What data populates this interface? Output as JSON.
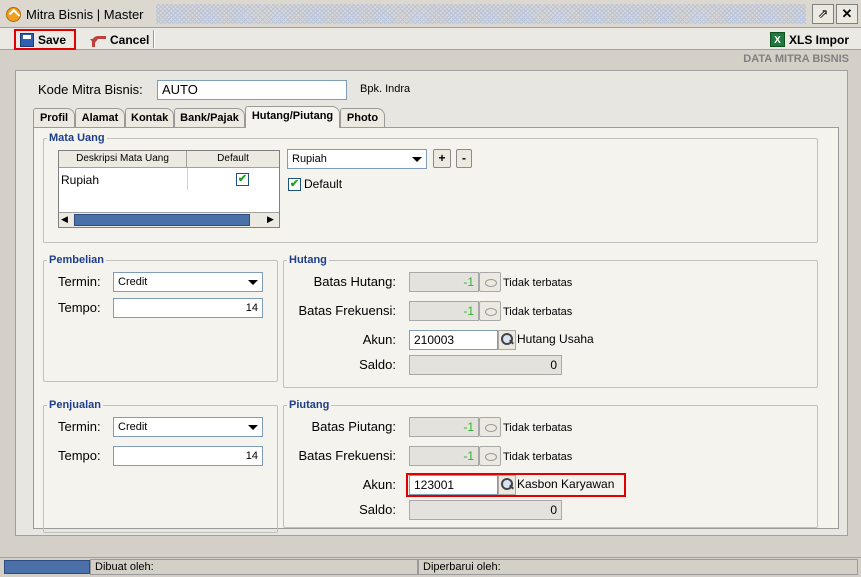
{
  "window": {
    "title": "Mitra Bisnis | Master",
    "restore_glyph": "⇗",
    "close_glyph": "✕"
  },
  "toolbar": {
    "save_label": "Save",
    "cancel_label": "Cancel",
    "xls_label": "XLS Impor"
  },
  "header": {
    "section_title": "DATA MITRA BISNIS",
    "kode_label": "Kode Mitra Bisnis:",
    "kode_value": "AUTO",
    "contact_name": "Bpk. Indra"
  },
  "tabs": [
    {
      "label": "Profil"
    },
    {
      "label": "Alamat"
    },
    {
      "label": "Kontak"
    },
    {
      "label": "Bank/Pajak"
    },
    {
      "label": "Hutang/Piutang",
      "active": true
    },
    {
      "label": "Photo"
    }
  ],
  "mata_uang": {
    "group_title": "Mata Uang",
    "col_desc": "Deskripsi Mata Uang",
    "col_default": "Default",
    "rows": [
      {
        "desc": "Rupiah",
        "default": true
      }
    ],
    "currency_select": "Rupiah",
    "add_label": "+",
    "remove_label": "-",
    "default_label": "Default",
    "default_checked": true,
    "check_glyph": "✔"
  },
  "pembelian": {
    "group_title": "Pembelian",
    "termin_label": "Termin:",
    "termin_value": "Credit",
    "tempo_label": "Tempo:",
    "tempo_value": "14"
  },
  "hutang": {
    "group_title": "Hutang",
    "batas_label": "Batas Hutang:",
    "batas_value": "-1",
    "batas_note": "Tidak terbatas",
    "frek_label": "Batas Frekuensi:",
    "frek_value": "-1",
    "frek_note": "Tidak terbatas",
    "akun_label": "Akun:",
    "akun_value": "210003",
    "akun_name": "Hutang Usaha",
    "saldo_label": "Saldo:",
    "saldo_value": "0"
  },
  "penjualan": {
    "group_title": "Penjualan",
    "termin_label": "Termin:",
    "termin_value": "Credit",
    "tempo_label": "Tempo:",
    "tempo_value": "14"
  },
  "piutang": {
    "group_title": "Piutang",
    "batas_label": "Batas Piutang:",
    "batas_value": "-1",
    "batas_note": "Tidak terbatas",
    "frek_label": "Batas Frekuensi:",
    "frek_value": "-1",
    "frek_note": "Tidak terbatas",
    "akun_label": "Akun:",
    "akun_value": "123001",
    "akun_name": "Kasbon Karyawan",
    "saldo_label": "Saldo:",
    "saldo_value": "0"
  },
  "status": {
    "dibuat": "Dibuat oleh:",
    "diperbarui": "Diperbarui oleh:"
  },
  "colors": {
    "highlight": "#e00000",
    "group_title": "#1f3e8a",
    "limit_value": "#2cb52c"
  }
}
